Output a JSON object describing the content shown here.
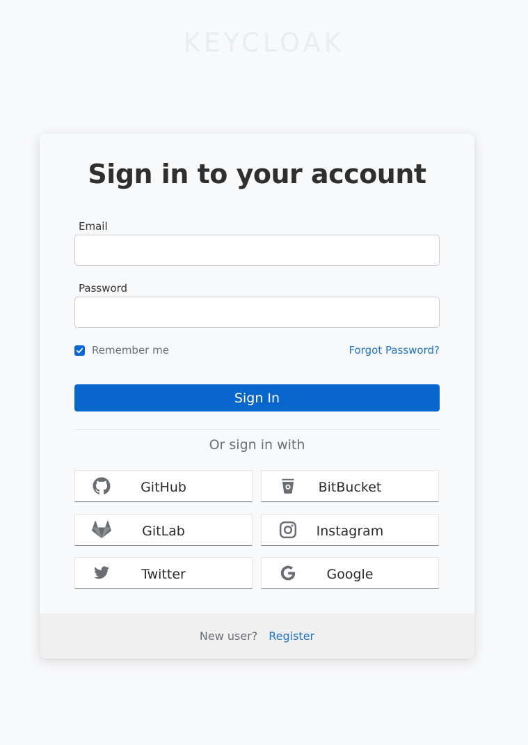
{
  "brand": "KEYCLOAK",
  "form": {
    "title": "Sign in to your account",
    "email_label": "Email",
    "email_value": "",
    "password_label": "Password",
    "password_value": "",
    "remember_label": "Remember me",
    "remember_checked": true,
    "forgot_label": "Forgot Password?",
    "submit_label": "Sign In"
  },
  "social": {
    "heading": "Or sign in with",
    "providers": [
      {
        "label": "GitHub",
        "icon": "github-icon"
      },
      {
        "label": "BitBucket",
        "icon": "bitbucket-icon"
      },
      {
        "label": "GitLab",
        "icon": "gitlab-icon"
      },
      {
        "label": "Instagram",
        "icon": "instagram-icon"
      },
      {
        "label": "Twitter",
        "icon": "twitter-icon"
      },
      {
        "label": "Google",
        "icon": "google-icon"
      }
    ]
  },
  "footer": {
    "prompt": "New user?",
    "register_label": "Register"
  },
  "colors": {
    "primary": "#0866cc",
    "link": "#1e74c7",
    "icon": "#6a6e73"
  }
}
